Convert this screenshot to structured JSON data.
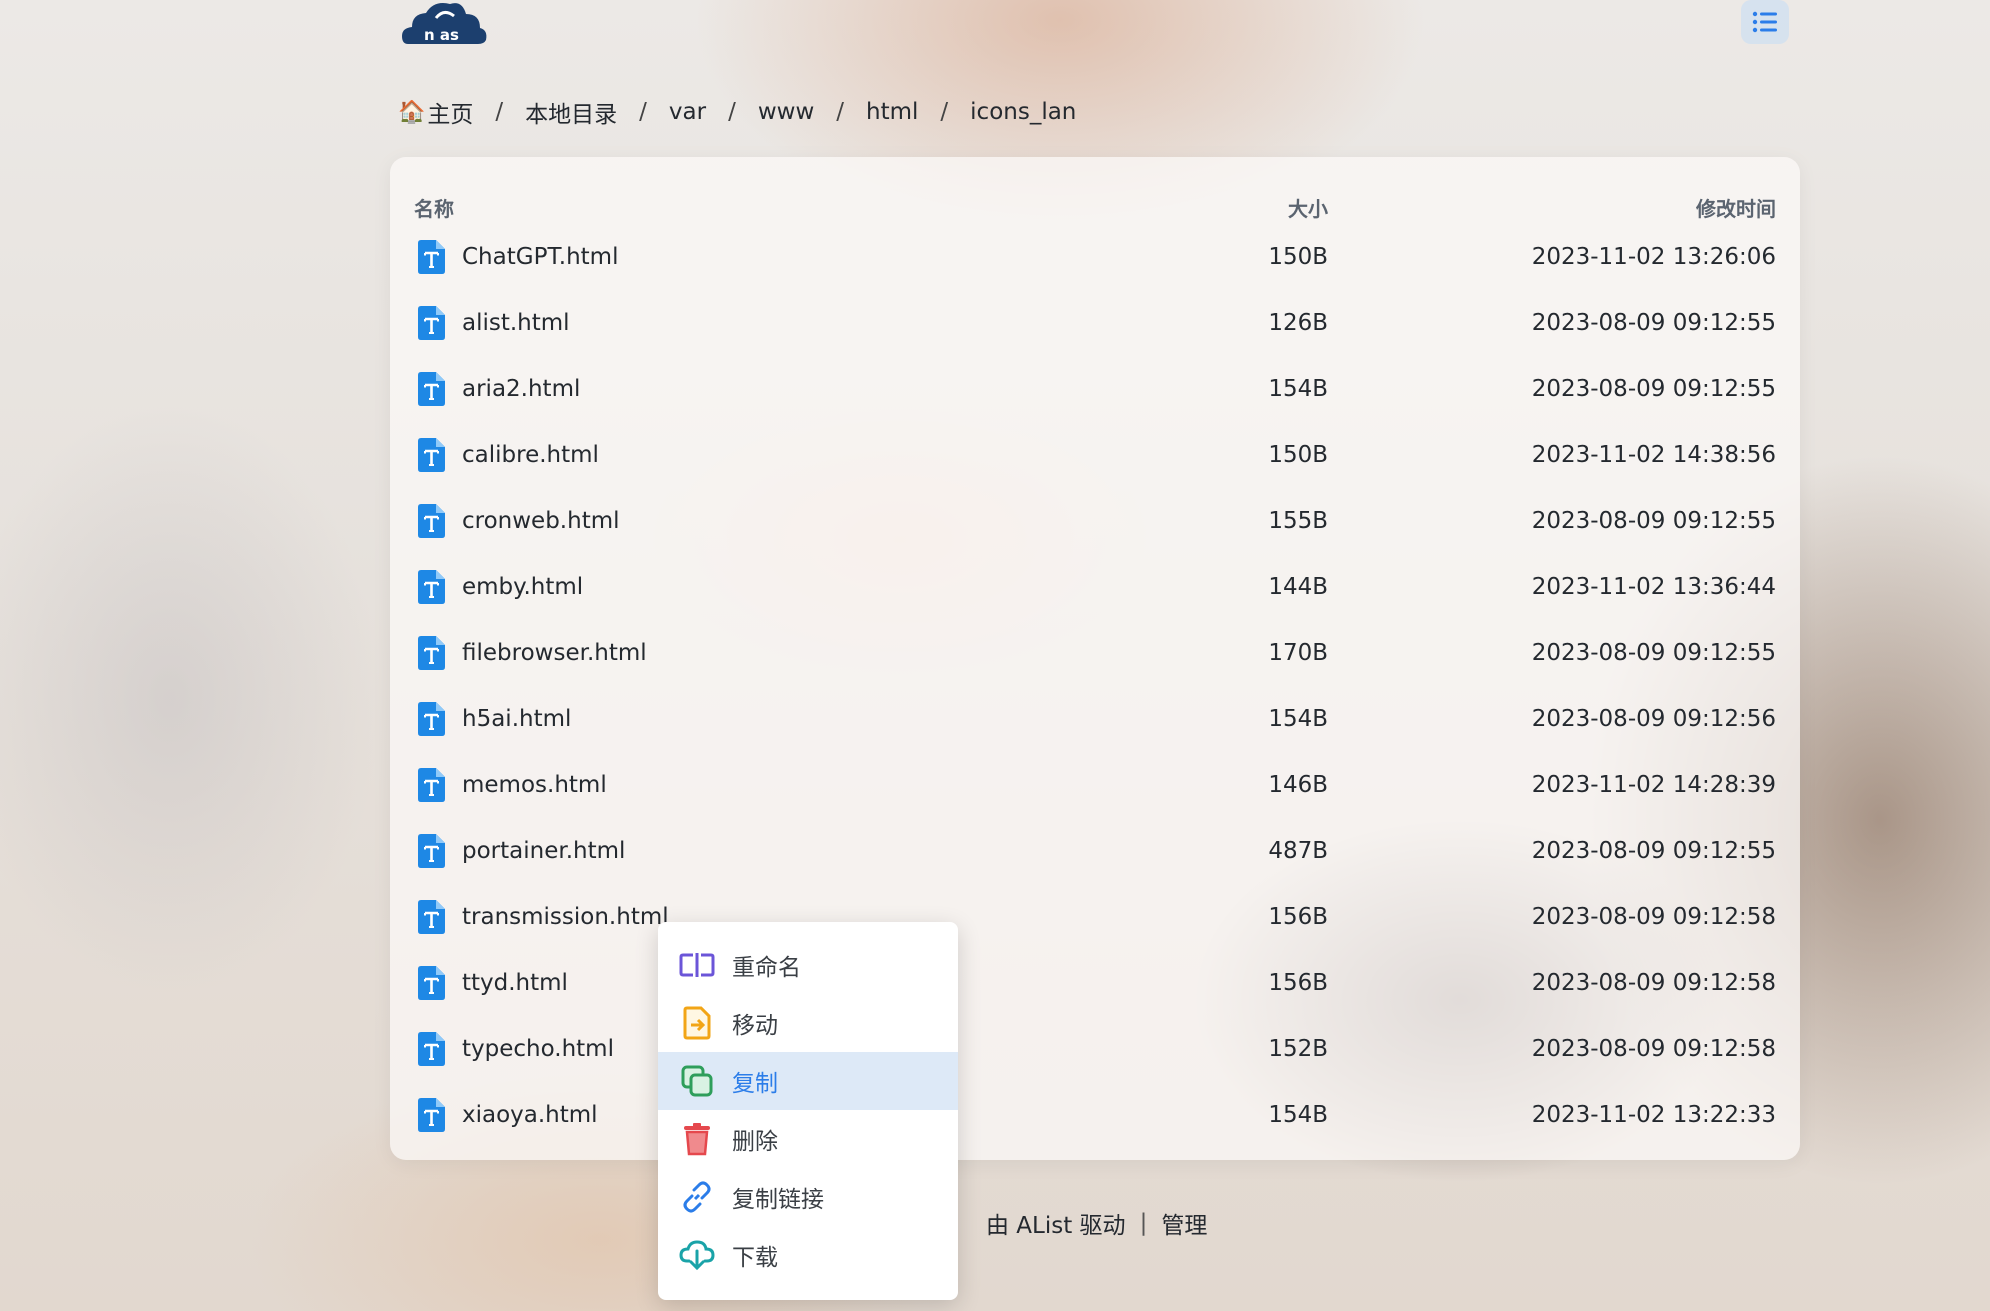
{
  "header": {
    "logo_text": "n as",
    "logo_icon": "cloud-logo-icon",
    "menu_icon": "list-menu-icon"
  },
  "breadcrumb": {
    "home_icon": "🏠",
    "items": [
      "主页",
      "本地目录",
      "var",
      "www",
      "html",
      "icons_lan"
    ],
    "separator": "/"
  },
  "table": {
    "columns": {
      "name": "名称",
      "size": "大小",
      "modified": "修改时间"
    },
    "file_icon": "text-file-icon",
    "rows": [
      {
        "name": "ChatGPT.html",
        "size": "150B",
        "modified": "2023-11-02 13:26:06"
      },
      {
        "name": "alist.html",
        "size": "126B",
        "modified": "2023-08-09 09:12:55"
      },
      {
        "name": "aria2.html",
        "size": "154B",
        "modified": "2023-08-09 09:12:55"
      },
      {
        "name": "calibre.html",
        "size": "150B",
        "modified": "2023-11-02 14:38:56"
      },
      {
        "name": "cronweb.html",
        "size": "155B",
        "modified": "2023-08-09 09:12:55"
      },
      {
        "name": "emby.html",
        "size": "144B",
        "modified": "2023-11-02 13:36:44"
      },
      {
        "name": "filebrowser.html",
        "size": "170B",
        "modified": "2023-08-09 09:12:55"
      },
      {
        "name": "h5ai.html",
        "size": "154B",
        "modified": "2023-08-09 09:12:56"
      },
      {
        "name": "memos.html",
        "size": "146B",
        "modified": "2023-11-02 14:28:39"
      },
      {
        "name": "portainer.html",
        "size": "487B",
        "modified": "2023-08-09 09:12:55"
      },
      {
        "name": "transmission.html",
        "size": "156B",
        "modified": "2023-08-09 09:12:58"
      },
      {
        "name": "ttyd.html",
        "size": "156B",
        "modified": "2023-08-09 09:12:58"
      },
      {
        "name": "typecho.html",
        "size": "152B",
        "modified": "2023-08-09 09:12:58"
      },
      {
        "name": "xiaoya.html",
        "size": "154B",
        "modified": "2023-11-02 13:22:33"
      }
    ]
  },
  "footer": {
    "powered_by": "由 AList 驱动",
    "separator": "|",
    "manage": "管理"
  },
  "context_menu": {
    "items": [
      {
        "label": "重命名",
        "icon": "rename-icon",
        "color": "#6b55d8"
      },
      {
        "label": "移动",
        "icon": "move-icon",
        "color": "#f2a516"
      },
      {
        "label": "复制",
        "icon": "copy-icon",
        "color": "#2e9e5b",
        "active": true
      },
      {
        "label": "删除",
        "icon": "trash-icon",
        "color": "#e5484d"
      },
      {
        "label": "复制链接",
        "icon": "link-icon",
        "color": "#2b7de9"
      },
      {
        "label": "下载",
        "icon": "cloud-download-icon",
        "color": "#1aa3a8"
      }
    ]
  },
  "colors": {
    "accent": "#2b7de9",
    "file_icon": "#1e88e5"
  }
}
